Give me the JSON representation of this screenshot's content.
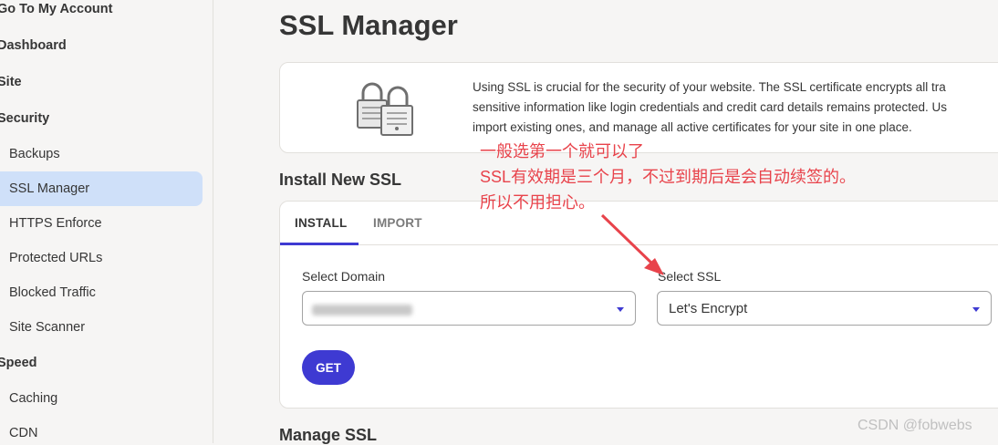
{
  "sidebar": {
    "items": [
      {
        "label": "Go To My Account",
        "type": "head"
      },
      {
        "label": "Dashboard",
        "type": "head"
      },
      {
        "label": "Site",
        "type": "head"
      },
      {
        "label": "Security",
        "type": "head"
      },
      {
        "label": "Backups",
        "type": "sub"
      },
      {
        "label": "SSL Manager",
        "type": "sub",
        "active": true
      },
      {
        "label": "HTTPS Enforce",
        "type": "sub"
      },
      {
        "label": "Protected URLs",
        "type": "sub"
      },
      {
        "label": "Blocked Traffic",
        "type": "sub"
      },
      {
        "label": "Site Scanner",
        "type": "sub"
      },
      {
        "label": "Speed",
        "type": "head"
      },
      {
        "label": "Caching",
        "type": "sub"
      },
      {
        "label": "CDN",
        "type": "sub"
      }
    ]
  },
  "page": {
    "title": "SSL Manager",
    "info_lines": [
      "Using SSL is crucial for the security of your website. The SSL certificate encrypts all tra",
      "sensitive information like login credentials and credit card details remains protected. Us",
      "import existing ones, and manage all active certificates for your site in one place."
    ],
    "install_title": "Install New SSL",
    "manage_title": "Manage SSL"
  },
  "install": {
    "tabs": [
      {
        "label": "INSTALL",
        "active": true
      },
      {
        "label": "IMPORT",
        "active": false
      }
    ],
    "domain_label": "Select Domain",
    "ssl_label": "Select SSL",
    "ssl_value": "Let's Encrypt",
    "get_label": "GET"
  },
  "annotation": {
    "lines": [
      "一般选第一个就可以了",
      "SSL有效期是三个月，不过到期后是会自动续签的。",
      "所以不用担心。"
    ]
  },
  "watermark": "CSDN @fobwebs",
  "colors": {
    "accent": "#3e3ad2",
    "active_bg": "#cfe0f9",
    "annotation": "#e8434b"
  },
  "icons": {
    "lock": "padlock-icon",
    "caret": "caret-down-icon",
    "arrow": "arrow-annotation"
  }
}
